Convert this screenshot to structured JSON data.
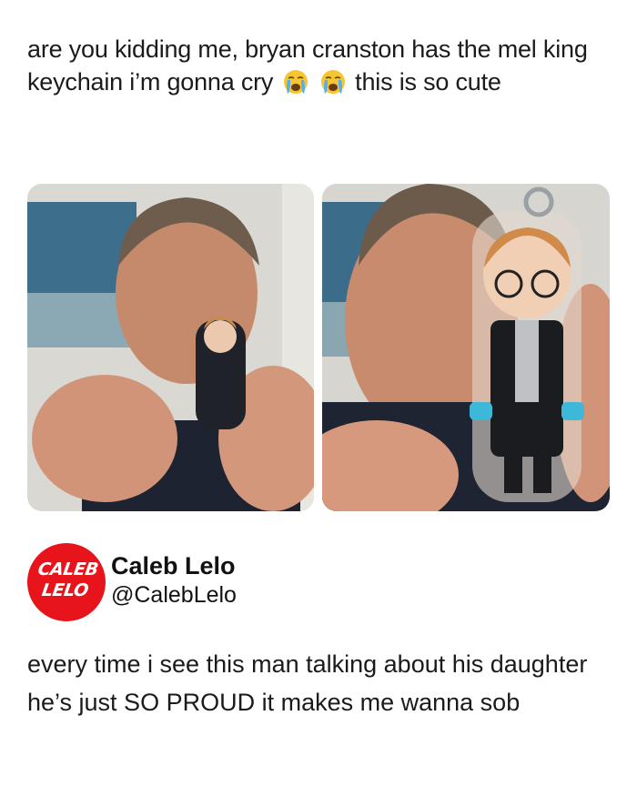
{
  "post": {
    "text_before_emoji": "are you kidding me, bryan cranston has the mel king keychain i’m gonna cry",
    "emojis": [
      "loudly-crying-face-emoji",
      "loudly-crying-face-emoji"
    ],
    "text_after_emoji": "this is so cute"
  },
  "photos": [
    {
      "name": "photo-holding-keychain-far",
      "icon": "man-holding-keychain-photo"
    },
    {
      "name": "photo-holding-keychain-close",
      "icon": "keychain-closeup-photo"
    }
  ],
  "quoted": {
    "avatar_line1": "CALEB",
    "avatar_line2": "LELO",
    "display_name": "Caleb Lelo",
    "handle": "@CalebLelo",
    "text": "every time i see this man talking about his daughter he’s just SO PROUD it makes me wanna sob"
  },
  "colors": {
    "avatar_red": "#e8141c",
    "text": "#1b1b1b",
    "background": "#ffffff"
  }
}
